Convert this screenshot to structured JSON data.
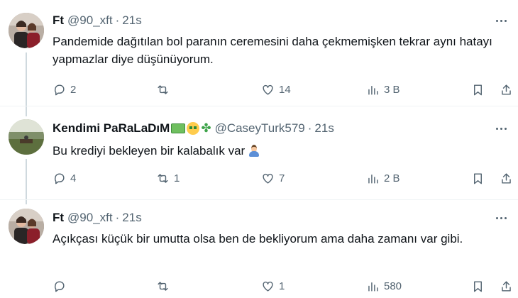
{
  "tweets": [
    {
      "display_name": "Ft",
      "handle": "@90_xft",
      "time": "21s",
      "text": "Pandemide dağıtılan bol paranın ceremesini daha çekmemişken tekrar aynı hatayı yapmazlar diye düşünüyorum.",
      "replies": "2",
      "retweets": "",
      "likes": "14",
      "views": "3 B",
      "avatar": "person-avatar"
    },
    {
      "display_name": "Kendimi PaRaLaDıM",
      "name_emojis": [
        "money-with-wings-emoji",
        "money-mouth-face-emoji",
        "four-leaf-clover-emoji"
      ],
      "handle": "@CaseyTurk579",
      "time": "21s",
      "text": "Bu krediyi bekleyen bir kalabalık var",
      "text_emoji": "person-tipping-hand-emoji",
      "replies": "4",
      "retweets": "1",
      "likes": "7",
      "views": "2 B",
      "avatar": "landscape-avatar"
    },
    {
      "display_name": "Ft",
      "handle": "@90_xft",
      "time": "21s",
      "text": "Açıkçası küçük bir umutta olsa ben de bekliyorum ama daha zamanı var gibi.",
      "replies": "",
      "retweets": "",
      "likes": "1",
      "views": "580",
      "avatar": "person-avatar"
    }
  ],
  "separator": "·",
  "colors": {
    "text": "#0f1419",
    "secondary": "#536471",
    "divider": "#eff3f4",
    "thread_line": "#cfd9de"
  }
}
